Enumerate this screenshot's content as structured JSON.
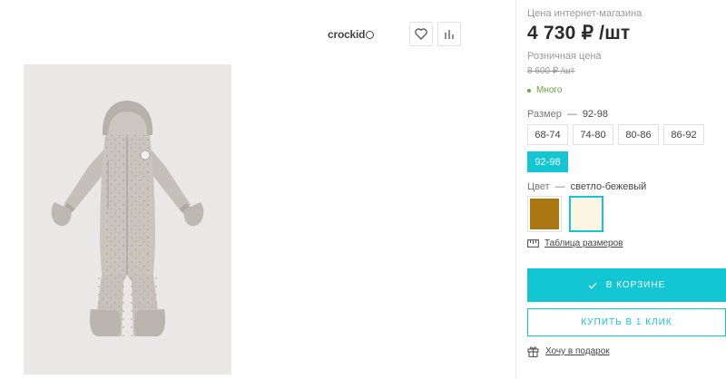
{
  "brand": {
    "name": "crockid"
  },
  "price": {
    "online_label": "Цена интернет-магазина",
    "online_value": "4 730 ₽ /шт",
    "retail_label": "Розничная цена",
    "retail_value": "8 600 ₽ /шт",
    "stock": "Много",
    "stock_color": "#6aa53a"
  },
  "size": {
    "label": "Размер",
    "dash": "—",
    "selected": "92-98",
    "options": [
      "68-74",
      "74-80",
      "80-86",
      "86-92",
      "92-98"
    ]
  },
  "color": {
    "label": "Цвет",
    "dash": "—",
    "selected": "светло-бежевый",
    "swatches": [
      {
        "hex": "#ab7712",
        "selected": false
      },
      {
        "hex": "#fbf5e2",
        "selected": true
      }
    ]
  },
  "links": {
    "size_table": "Таблица размеров",
    "gift": "Хочу в подарок"
  },
  "buttons": {
    "cart": "В КОРЗИНЕ",
    "one_click": "КУПИТЬ В 1 КЛИК"
  },
  "accent": "#12c6d3",
  "icons": [
    "heart-icon",
    "compare-icon",
    "check-icon",
    "ruler-icon",
    "gift-icon"
  ]
}
